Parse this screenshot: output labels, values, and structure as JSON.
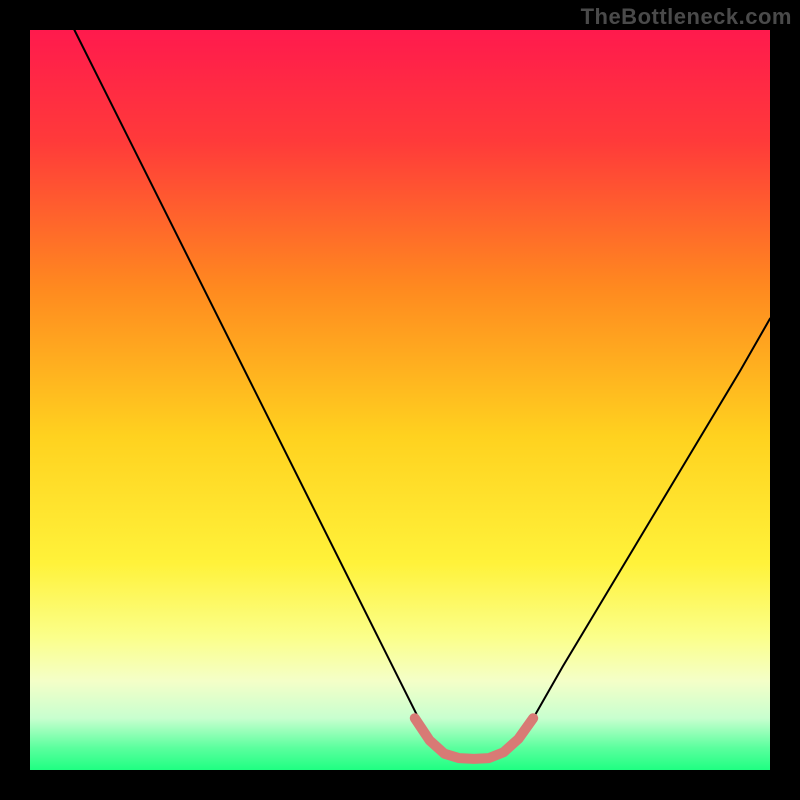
{
  "watermark": "TheBottleneck.com",
  "chart_data": {
    "type": "line",
    "title": "",
    "xlabel": "",
    "ylabel": "",
    "xlim": [
      0,
      100
    ],
    "ylim": [
      0,
      100
    ],
    "background": {
      "type": "vertical-gradient",
      "stops": [
        {
          "offset": 0.0,
          "color": "#ff1a4d"
        },
        {
          "offset": 0.15,
          "color": "#ff3a3a"
        },
        {
          "offset": 0.35,
          "color": "#ff8a1f"
        },
        {
          "offset": 0.55,
          "color": "#ffd21f"
        },
        {
          "offset": 0.72,
          "color": "#fff23a"
        },
        {
          "offset": 0.82,
          "color": "#fbff8a"
        },
        {
          "offset": 0.88,
          "color": "#f4ffc8"
        },
        {
          "offset": 0.93,
          "color": "#c8ffcf"
        },
        {
          "offset": 0.97,
          "color": "#5bff9e"
        },
        {
          "offset": 1.0,
          "color": "#1fff82"
        }
      ]
    },
    "series": [
      {
        "name": "bottleneck-curve",
        "color": "#000000",
        "width": 2,
        "points": [
          {
            "x": 6,
            "y": 100
          },
          {
            "x": 10,
            "y": 92
          },
          {
            "x": 15,
            "y": 82
          },
          {
            "x": 20,
            "y": 72
          },
          {
            "x": 25,
            "y": 62
          },
          {
            "x": 30,
            "y": 52
          },
          {
            "x": 35,
            "y": 42
          },
          {
            "x": 40,
            "y": 32
          },
          {
            "x": 45,
            "y": 22
          },
          {
            "x": 50,
            "y": 12
          },
          {
            "x": 53,
            "y": 6
          },
          {
            "x": 55,
            "y": 3
          },
          {
            "x": 58,
            "y": 1.5
          },
          {
            "x": 62,
            "y": 1.5
          },
          {
            "x": 65,
            "y": 3
          },
          {
            "x": 68,
            "y": 7
          },
          {
            "x": 72,
            "y": 14
          },
          {
            "x": 78,
            "y": 24
          },
          {
            "x": 84,
            "y": 34
          },
          {
            "x": 90,
            "y": 44
          },
          {
            "x": 96,
            "y": 54
          },
          {
            "x": 100,
            "y": 61
          }
        ]
      },
      {
        "name": "optimal-band",
        "color": "#d87a75",
        "width": 10,
        "points": [
          {
            "x": 52,
            "y": 7
          },
          {
            "x": 54,
            "y": 4
          },
          {
            "x": 56,
            "y": 2.2
          },
          {
            "x": 58,
            "y": 1.6
          },
          {
            "x": 60,
            "y": 1.5
          },
          {
            "x": 62,
            "y": 1.6
          },
          {
            "x": 64,
            "y": 2.4
          },
          {
            "x": 66,
            "y": 4.2
          },
          {
            "x": 68,
            "y": 7
          }
        ]
      }
    ]
  }
}
